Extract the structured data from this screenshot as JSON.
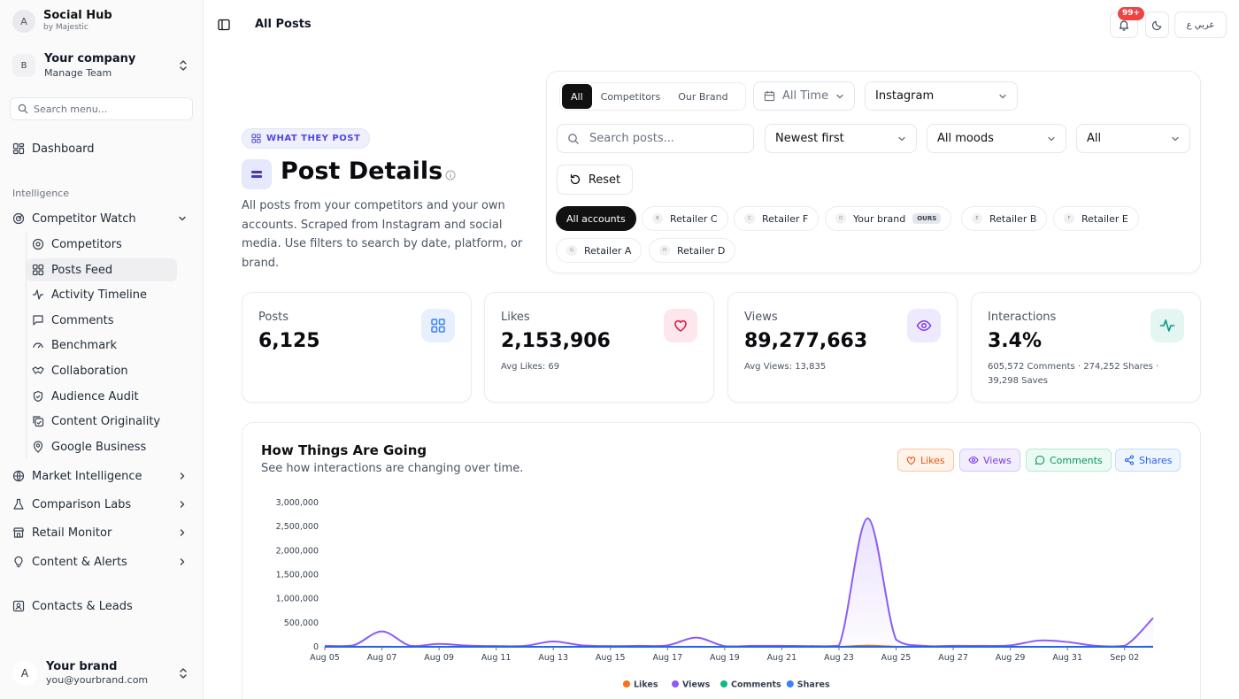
{
  "app": {
    "title": "Social Hub",
    "subtitle": "by Majestic",
    "avatar": "A"
  },
  "company": {
    "avatar": "B",
    "name": "Your company",
    "subtitle": "Manage Team"
  },
  "sidebar": {
    "search_placeholder": "Search menu...",
    "dashboard": "Dashboard",
    "section_label": "Intelligence",
    "competitor_watch": "Competitor Watch",
    "subitems": [
      {
        "label": "Competitors",
        "icon": "disc-icon"
      },
      {
        "label": "Posts Feed",
        "icon": "grid-icon"
      },
      {
        "label": "Activity Timeline",
        "icon": "activity-icon"
      },
      {
        "label": "Comments",
        "icon": "comment-icon"
      },
      {
        "label": "Benchmark",
        "icon": "gauge-icon"
      },
      {
        "label": "Collaboration",
        "icon": "handshake-icon"
      },
      {
        "label": "Audience Audit",
        "icon": "shield-check-icon"
      },
      {
        "label": "Content Originality",
        "icon": "copy-check-icon"
      },
      {
        "label": "Google Business",
        "icon": "map-pin-icon"
      }
    ],
    "groups": [
      {
        "label": "Market Intelligence",
        "icon": "globe-icon"
      },
      {
        "label": "Comparison Labs",
        "icon": "flask-icon"
      },
      {
        "label": "Retail Monitor",
        "icon": "store-icon"
      },
      {
        "label": "Content & Alerts",
        "icon": "lightbulb-icon"
      }
    ],
    "contacts": "Contacts & Leads"
  },
  "user": {
    "avatar": "A",
    "name": "Your brand",
    "email": "you@yourbrand.com"
  },
  "header": {
    "title": "All Posts",
    "notif_badge": "99+",
    "lang_label": "عربي ع"
  },
  "hero": {
    "tag": "WHAT THEY POST",
    "title": "Post Details",
    "description": "All posts from your competitors and your own accounts. Scraped from Instagram and social media. Use filters to search by date, platform, or brand."
  },
  "filters": {
    "segments": [
      "All",
      "Competitors",
      "Our Brand"
    ],
    "time": "All Time",
    "platform": "Instagram",
    "search_placeholder": "Search posts...",
    "sort": "Newest first",
    "mood": "All moods",
    "type": "All",
    "reset": "Reset",
    "all_accounts": "All accounts",
    "accounts": [
      {
        "initial": "B",
        "name": "Retailer C"
      },
      {
        "initial": "C",
        "name": "Retailer F"
      },
      {
        "initial": "D",
        "name": "Your brand",
        "badge": "OURS"
      },
      {
        "initial": "E",
        "name": "Retailer B"
      },
      {
        "initial": "F",
        "name": "Retailer E"
      },
      {
        "initial": "G",
        "name": "Retailer A"
      },
      {
        "initial": "H",
        "name": "Retailer D"
      }
    ]
  },
  "kpis": [
    {
      "label": "Posts",
      "value": "6,125",
      "sub": "",
      "icon": "grid-icon",
      "color": "#3b82f6"
    },
    {
      "label": "Likes",
      "value": "2,153,906",
      "sub": "Avg Likes: 69",
      "icon": "heart-icon",
      "color": "#e11d48"
    },
    {
      "label": "Views",
      "value": "89,277,663",
      "sub": "Avg Views: 13,835",
      "icon": "eye-icon",
      "color": "#7c3aed"
    },
    {
      "label": "Interactions",
      "value": "3.4%",
      "sub": "605,572 Comments · 274,252 Shares · 39,298 Saves",
      "icon": "activity-icon",
      "color": "#0d9488"
    }
  ],
  "chart": {
    "title": "How Things Are Going",
    "subtitle": "See how interactions are changing over time.",
    "toggles": [
      {
        "label": "Likes",
        "icon": "heart-icon",
        "color": "#ea580c"
      },
      {
        "label": "Views",
        "icon": "eye-icon",
        "color": "#8b5cf6"
      },
      {
        "label": "Comments",
        "icon": "comment-icon",
        "color": "#10b981"
      },
      {
        "label": "Shares",
        "icon": "share-icon",
        "color": "#3b82f6"
      }
    ]
  },
  "chart_data": {
    "type": "area",
    "title": "",
    "xlabel": "",
    "ylabel": "",
    "ylim": [
      0,
      3000000
    ],
    "yticks": [
      "0",
      "500,000",
      "1,000,000",
      "1,500,000",
      "2,000,000",
      "2,500,000",
      "3,000,000"
    ],
    "x": [
      "Aug 05",
      "Aug 06",
      "Aug 07",
      "Aug 08",
      "Aug 09",
      "Aug 10",
      "Aug 11",
      "Aug 12",
      "Aug 13",
      "Aug 14",
      "Aug 15",
      "Aug 16",
      "Aug 17",
      "Aug 18",
      "Aug 19",
      "Aug 20",
      "Aug 21",
      "Aug 22",
      "Aug 23",
      "Aug 24",
      "Aug 25",
      "Aug 26",
      "Aug 27",
      "Aug 28",
      "Aug 29",
      "Aug 30",
      "Aug 31",
      "Sep 01",
      "Sep 02",
      "Sep 03"
    ],
    "xticks": [
      "Aug 05",
      "Aug 07",
      "Aug 09",
      "Aug 11",
      "Aug 13",
      "Aug 15",
      "Aug 17",
      "Aug 19",
      "Aug 21",
      "Aug 23",
      "Aug 25",
      "Aug 27",
      "Aug 29",
      "Aug 31",
      "Sep 02"
    ],
    "grid": false,
    "legend": "bottom",
    "series": [
      {
        "name": "Likes",
        "color": "#f97316",
        "values": [
          5000,
          4000,
          6000,
          3000,
          4000,
          3000,
          3000,
          2000,
          4000,
          3000,
          2000,
          2000,
          3000,
          5000,
          3000,
          2000,
          2000,
          2000,
          3000,
          30000,
          5000,
          2000,
          2000,
          2000,
          2000,
          3000,
          3000,
          2000,
          2000,
          8000
        ]
      },
      {
        "name": "Views",
        "color": "#8b5cf6",
        "values": [
          20000,
          30000,
          320000,
          20000,
          60000,
          25000,
          15000,
          20000,
          110000,
          30000,
          15000,
          20000,
          30000,
          190000,
          15000,
          20000,
          20000,
          15000,
          25000,
          2670000,
          150000,
          20000,
          20000,
          20000,
          30000,
          130000,
          100000,
          20000,
          20000,
          600000
        ]
      },
      {
        "name": "Comments",
        "color": "#10b981",
        "values": [
          1000,
          1000,
          2000,
          1000,
          1000,
          1000,
          1000,
          1000,
          1000,
          1000,
          1000,
          1000,
          1000,
          1000,
          1000,
          1000,
          1000,
          1000,
          1000,
          8000,
          1000,
          1000,
          1000,
          1000,
          1000,
          1000,
          1000,
          1000,
          1000,
          2000
        ]
      },
      {
        "name": "Shares",
        "color": "#3b82f6",
        "values": [
          2000,
          2000,
          3000,
          2000,
          2000,
          2000,
          2000,
          2000,
          2000,
          2000,
          2000,
          2000,
          2000,
          2000,
          2000,
          2000,
          2000,
          2000,
          2000,
          6000,
          2000,
          2000,
          2000,
          2000,
          2000,
          2000,
          2000,
          2000,
          2000,
          3000
        ]
      }
    ]
  }
}
